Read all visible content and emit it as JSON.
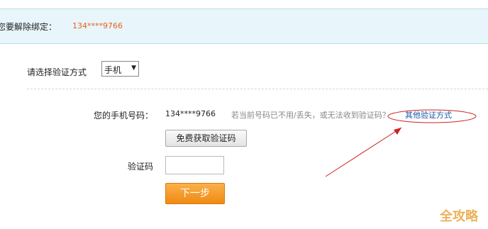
{
  "banner": {
    "label": "您要解除绑定：",
    "phone": "134****9766"
  },
  "verify_method": {
    "label": "请选择验证方式",
    "selected": "手机",
    "arrow_icon": "triangle-down-icon"
  },
  "phone_row": {
    "label": "您的手机号码：",
    "value": "134****9766",
    "help_text": "若当前号码已不用/丢失，或无法收到验证码？",
    "help_link": "其他验证方式"
  },
  "get_code_button": "免费获取验证码",
  "code_field": {
    "label": "验证码",
    "value": ""
  },
  "next_button": "下一步",
  "watermark": "全攻略",
  "colors": {
    "banner_bg": "#e8f6fb",
    "phone_orange": "#e8601c",
    "link_blue": "#1a55a8",
    "next_button": "#f39c1e",
    "annotation_red": "#cc2222"
  }
}
